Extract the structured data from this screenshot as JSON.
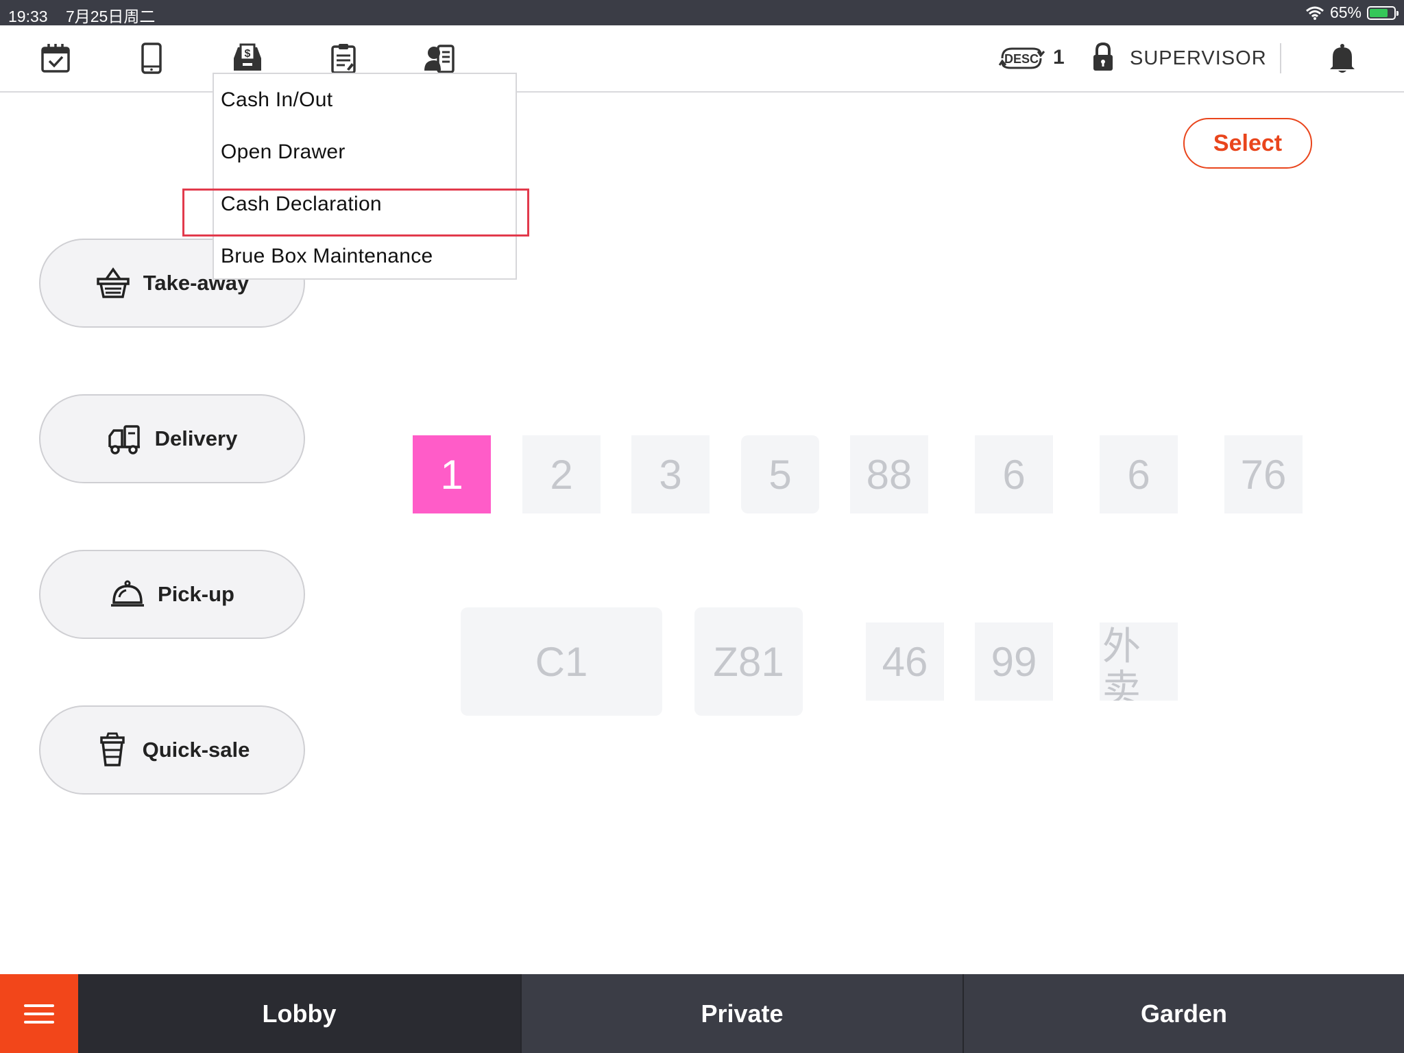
{
  "status_bar": {
    "time": "19:33",
    "date": "7月25日周二",
    "battery_percent": "65%",
    "battery_level": 0.65,
    "icons": [
      "wifi-icon",
      "battery-icon"
    ]
  },
  "toolbar": {
    "icons": [
      "calendar-check-icon",
      "tablet-icon",
      "cash-drawer-icon",
      "clipboard-icon",
      "staff-card-icon"
    ],
    "desc_label": "DESC",
    "desc_count": "1",
    "role": "SUPERVISOR"
  },
  "dropdown": {
    "items": [
      {
        "label": "Cash In/Out"
      },
      {
        "label": "Open Drawer"
      },
      {
        "label": "Cash Declaration",
        "highlighted": true
      },
      {
        "label": "Brue Box Maintenance"
      }
    ]
  },
  "select_label": "Select",
  "order_types": [
    {
      "label": "Take-away",
      "icon": "basket-icon"
    },
    {
      "label": "Delivery",
      "icon": "delivery-truck-icon"
    },
    {
      "label": "Pick-up",
      "icon": "cloche-icon"
    },
    {
      "label": "Quick-sale",
      "icon": "cup-icon"
    }
  ],
  "tables": {
    "row1": [
      "1",
      "2",
      "3",
      "5",
      "88",
      "6",
      "6",
      "76"
    ],
    "row2": [
      "C1",
      "Z81",
      "46",
      "99",
      "外卖"
    ],
    "active": "1"
  },
  "bottom_tabs": [
    {
      "label": "Lobby",
      "active": true
    },
    {
      "label": "Private",
      "active": false
    },
    {
      "label": "Garden",
      "active": false
    }
  ],
  "colors": {
    "accent": "#e9451c",
    "active_table": "#ff5cc8",
    "highlight_box": "#e23a4c",
    "dark_bar": "#3b3d46"
  }
}
